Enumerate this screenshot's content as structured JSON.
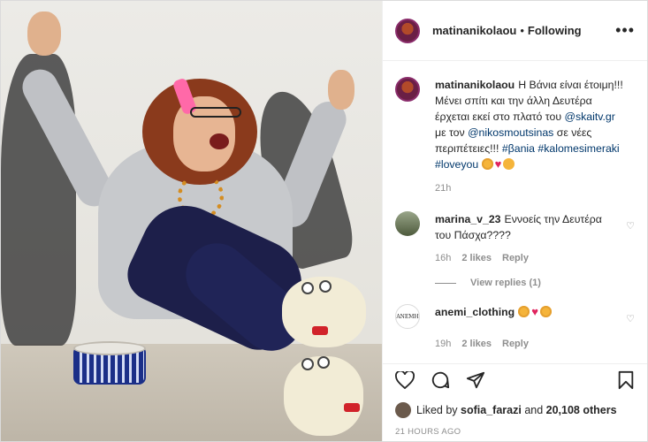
{
  "post": {
    "author": "matinanikolaou",
    "separator": "•",
    "follow_state": "Following",
    "more_label": "•••"
  },
  "caption": {
    "author": "matinanikolaou",
    "text_1": "Η Βάνια είναι έτοιμη!!! Μένει σπίτι και την άλλη Δευτέρα έρχεται εκεί στο πλατό του ",
    "mention_1": "@skaitv.gr",
    "text_2": " με τον ",
    "mention_2": "@nikosmoutsinas",
    "text_3": " σε νέες περιπέτειες!!! ",
    "hashtag_1": "#βania",
    "hashtag_2": "#kalomesimeraki",
    "hashtag_3": "#loveyou",
    "time": "21h"
  },
  "comments": [
    {
      "author": "marina_v_23",
      "text": "Εννοείς την Δευτέρα του Πάσχα????",
      "time": "16h",
      "likes": "2 likes",
      "reply": "Reply",
      "view_replies": "View replies (1)"
    },
    {
      "author": "anemi_clothing",
      "avatar_text": "ΑΝΕΜΗ",
      "time": "19h",
      "likes": "2 likes",
      "reply": "Reply"
    }
  ],
  "likes_bar": {
    "prefix": "Liked by ",
    "user": "sofia_farazi",
    "middle": " and ",
    "count": "20,108 others"
  },
  "timestamp": "21 HOURS AGO",
  "icons": {
    "heart": "heart-icon",
    "comment": "comment-icon",
    "share": "share-icon",
    "save": "save-icon"
  },
  "colors": {
    "link": "#00376b",
    "muted": "#8e8e8e",
    "text": "#262626",
    "heart": "#e0245e"
  }
}
